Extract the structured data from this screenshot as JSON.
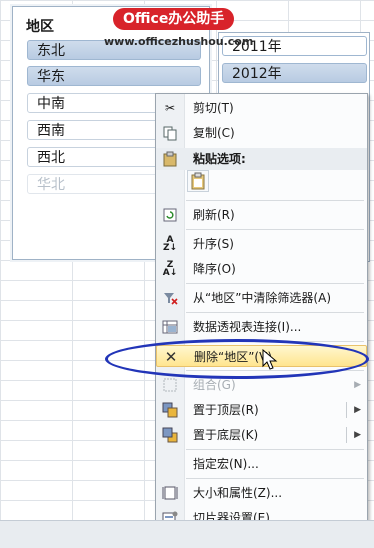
{
  "watermark": {
    "logo_text": "Office办公助手",
    "url": "www.officezhushou.com"
  },
  "slicer_region": {
    "title": "地区",
    "items": [
      {
        "label": "东北",
        "state": "selected"
      },
      {
        "label": "华东",
        "state": "selected"
      },
      {
        "label": "中南",
        "state": "plain"
      },
      {
        "label": "西南",
        "state": "plain"
      },
      {
        "label": "西北",
        "state": "plain"
      },
      {
        "label": "华北",
        "state": "dim"
      }
    ]
  },
  "slicer_year": {
    "items": [
      {
        "label": "2011年",
        "state": "plain"
      },
      {
        "label": "2012年",
        "state": "selected"
      }
    ]
  },
  "context_menu": {
    "cut": "剪切(T)",
    "copy": "复制(C)",
    "paste_options": "粘贴选项:",
    "refresh": "刷新(R)",
    "sort_asc": "升序(S)",
    "sort_desc": "降序(O)",
    "clear_filter": "从“地区”中清除筛选器(A)",
    "pivot_connections": "数据透视表连接(I)...",
    "delete": "删除“地区”(V)",
    "group": "组合(G)",
    "bring_front": "置于顶层(R)",
    "send_back": "置于底层(K)",
    "assign_macro": "指定宏(N)...",
    "size_props": "大小和属性(Z)...",
    "slicer_settings": "切片器设置(E)..."
  },
  "icons": {
    "cut": "scissors-icon",
    "copy": "copy-icon",
    "paste": "clipboard-icon",
    "refresh": "refresh-icon",
    "sort_asc": "sort-ascending-icon",
    "sort_desc": "sort-descending-icon",
    "clear_filter": "clear-filter-icon",
    "pivot": "pivot-table-icon",
    "delete": "delete-x-icon",
    "group": "group-icon",
    "bring_front": "bring-to-front-icon",
    "send_back": "send-to-back-icon",
    "size": "size-properties-icon",
    "settings": "slicer-settings-icon"
  },
  "colors": {
    "highlight": "#ffe58f",
    "annotation_ellipse": "#2235b8",
    "logo_red": "#d8232a"
  }
}
